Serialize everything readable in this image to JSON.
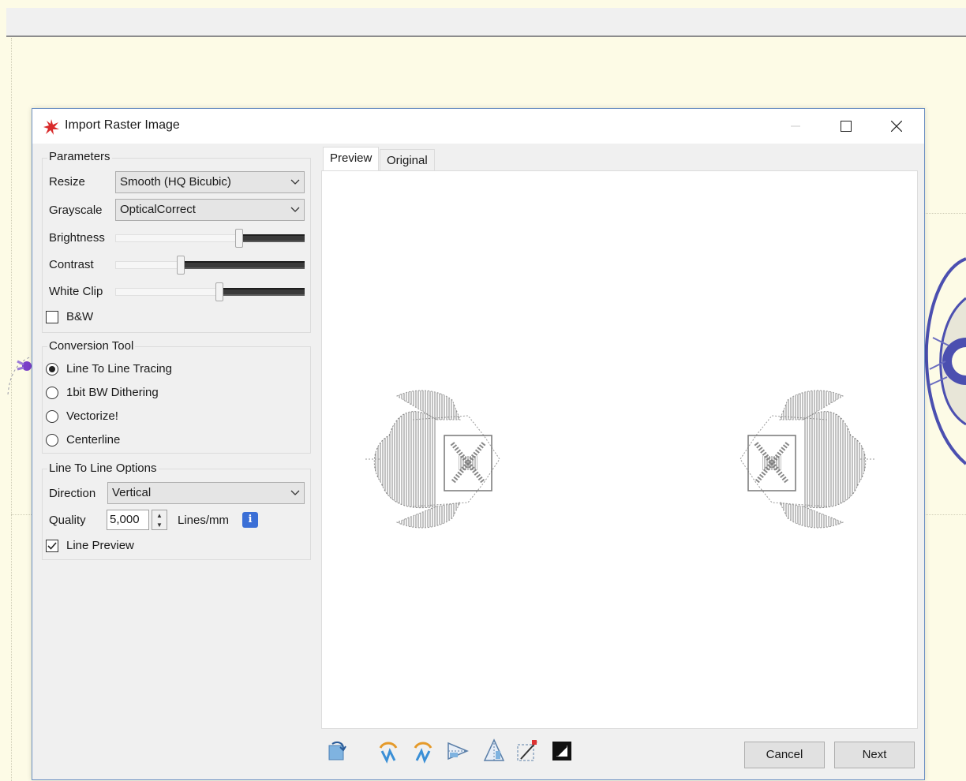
{
  "dialog": {
    "title": "Import Raster Image"
  },
  "parameters": {
    "group_label": "Parameters",
    "resize_label": "Resize",
    "resize_value": "Smooth (HQ Bicubic)",
    "grayscale_label": "Grayscale",
    "grayscale_value": "OpticalCorrect",
    "brightness_label": "Brightness",
    "brightness_level": 0.66,
    "contrast_label": "Contrast",
    "contrast_level": 0.34,
    "whiteclip_label": "White Clip",
    "whiteclip_level": 0.55,
    "bw_label": "B&W",
    "bw_checked": false
  },
  "conversion": {
    "group_label": "Conversion Tool",
    "options": [
      "Line To Line Tracing",
      "1bit BW Dithering",
      "Vectorize!",
      "Centerline"
    ],
    "selected_index": 0
  },
  "line_options": {
    "group_label": "Line To Line Options",
    "direction_label": "Direction",
    "direction_value": "Vertical",
    "quality_label": "Quality",
    "quality_value": "5,000",
    "quality_unit": "Lines/mm",
    "line_preview_label": "Line Preview",
    "line_preview_checked": true
  },
  "tabs": {
    "preview": "Preview",
    "original": "Original"
  },
  "toolbar_icons": [
    "reset-icon",
    "rotate-left-icon",
    "rotate-right-icon",
    "flip-horizontal-icon",
    "flip-vertical-icon",
    "crop-icon",
    "invert-icon"
  ],
  "buttons": {
    "cancel": "Cancel",
    "next": "Next"
  },
  "colors": {
    "accent": "#3b6fd6",
    "logo": "#d92b2b"
  }
}
